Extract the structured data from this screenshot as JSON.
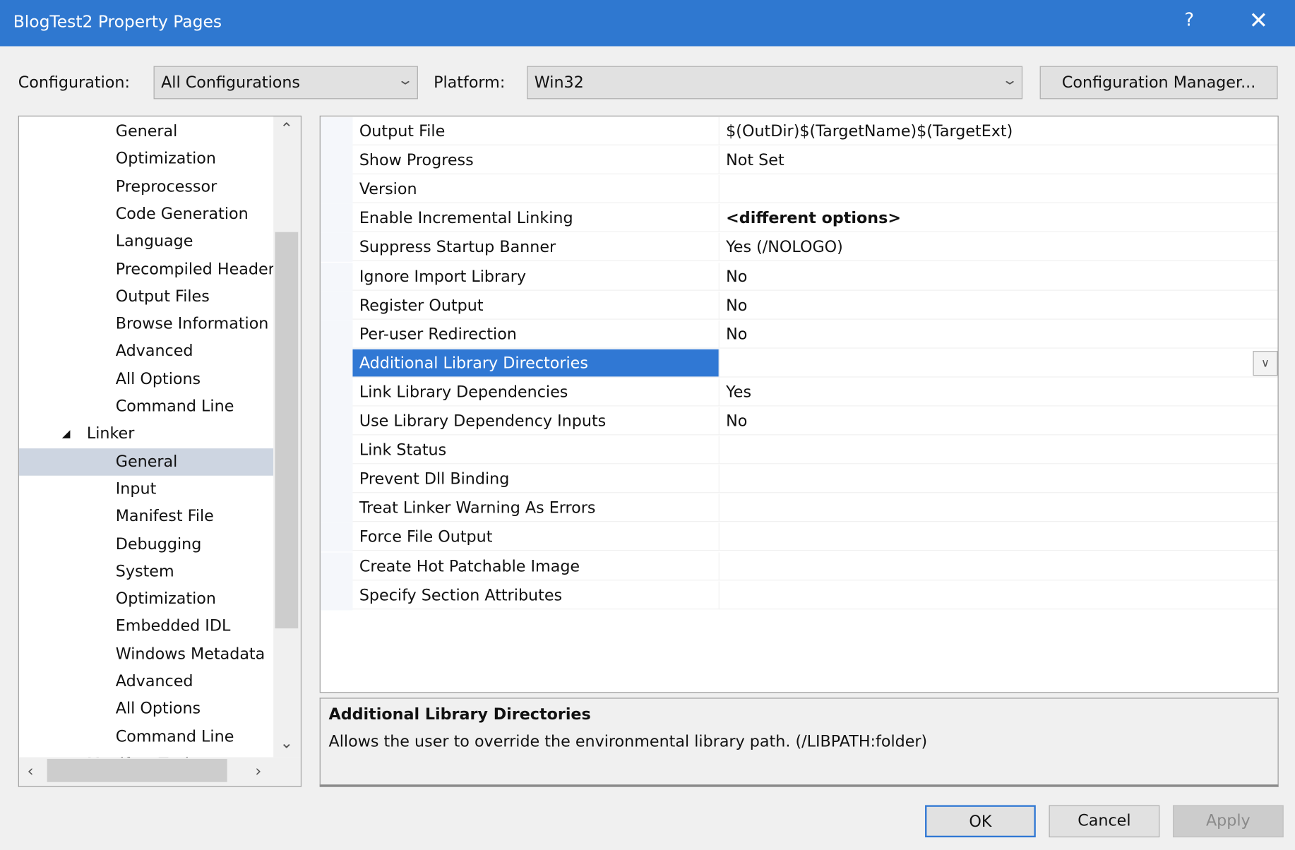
{
  "window": {
    "title": "BlogTest2 Property Pages",
    "help_icon": "?",
    "close_icon": "✕"
  },
  "toolbar": {
    "configuration_label": "Configuration:",
    "configuration_value": "All Configurations",
    "platform_label": "Platform:",
    "platform_value": "Win32",
    "config_manager_label": "Configuration Manager..."
  },
  "tree": {
    "items": [
      {
        "label": "General",
        "level": 2
      },
      {
        "label": "Optimization",
        "level": 2
      },
      {
        "label": "Preprocessor",
        "level": 2
      },
      {
        "label": "Code Generation",
        "level": 2
      },
      {
        "label": "Language",
        "level": 2
      },
      {
        "label": "Precompiled Headers",
        "level": 2
      },
      {
        "label": "Output Files",
        "level": 2
      },
      {
        "label": "Browse Information",
        "level": 2
      },
      {
        "label": "Advanced",
        "level": 2
      },
      {
        "label": "All Options",
        "level": 2
      },
      {
        "label": "Command Line",
        "level": 2
      },
      {
        "label": "Linker",
        "level": 1,
        "expanded": true
      },
      {
        "label": "General",
        "level": 2,
        "selected": true
      },
      {
        "label": "Input",
        "level": 2
      },
      {
        "label": "Manifest File",
        "level": 2
      },
      {
        "label": "Debugging",
        "level": 2
      },
      {
        "label": "System",
        "level": 2
      },
      {
        "label": "Optimization",
        "level": 2
      },
      {
        "label": "Embedded IDL",
        "level": 2
      },
      {
        "label": "Windows Metadata",
        "level": 2
      },
      {
        "label": "Advanced",
        "level": 2
      },
      {
        "label": "All Options",
        "level": 2
      },
      {
        "label": "Command Line",
        "level": 2
      },
      {
        "label": "Manifest Tool",
        "level": 1
      }
    ]
  },
  "properties": [
    {
      "name": "Output File",
      "value": "$(OutDir)$(TargetName)$(TargetExt)"
    },
    {
      "name": "Show Progress",
      "value": "Not Set"
    },
    {
      "name": "Version",
      "value": ""
    },
    {
      "name": "Enable Incremental Linking",
      "value": "<different options>",
      "bold": true
    },
    {
      "name": "Suppress Startup Banner",
      "value": "Yes (/NOLOGO)"
    },
    {
      "name": "Ignore Import Library",
      "value": "No"
    },
    {
      "name": "Register Output",
      "value": "No"
    },
    {
      "name": "Per-user Redirection",
      "value": "No"
    },
    {
      "name": "Additional Library Directories",
      "value": "",
      "selected": true
    },
    {
      "name": "Link Library Dependencies",
      "value": "Yes"
    },
    {
      "name": "Use Library Dependency Inputs",
      "value": "No"
    },
    {
      "name": "Link Status",
      "value": ""
    },
    {
      "name": "Prevent Dll Binding",
      "value": ""
    },
    {
      "name": "Treat Linker Warning As Errors",
      "value": ""
    },
    {
      "name": "Force File Output",
      "value": ""
    },
    {
      "name": "Create Hot Patchable Image",
      "value": ""
    },
    {
      "name": "Specify Section Attributes",
      "value": ""
    }
  ],
  "description": {
    "title": "Additional Library Directories",
    "text": "Allows the user to override the environmental library path. (/LIBPATH:folder)"
  },
  "buttons": {
    "ok": "OK",
    "cancel": "Cancel",
    "apply": "Apply"
  },
  "colors": {
    "titlebar": "#2f78d0",
    "selection": "#3078d4",
    "tree_selection": "#cdd5e1"
  }
}
